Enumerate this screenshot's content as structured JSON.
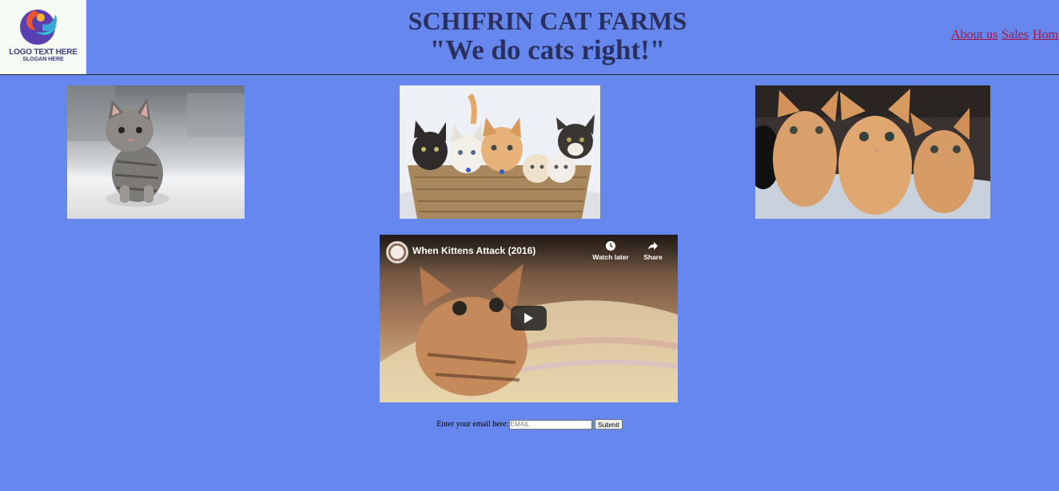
{
  "header": {
    "logo": {
      "text": "LOGO TEXT HERE",
      "slogan": "SLOGAN HERE",
      "colors": [
        "#e8552f",
        "#3aa7d6",
        "#5a3fb0"
      ]
    },
    "title": "SCHIFRIN CAT FARMS",
    "tagline": "\"We do cats right!\""
  },
  "nav": {
    "links": [
      "About us",
      "Sales",
      "Hom"
    ]
  },
  "gallery": {
    "images": [
      {
        "icon": "tabby-kitten-photo"
      },
      {
        "icon": "kittens-in-basket-photo"
      },
      {
        "icon": "orange-kittens-photo"
      }
    ]
  },
  "video": {
    "title": "When Kittens Attack (2016)",
    "watch_later": "Watch later",
    "share": "Share",
    "icons": [
      "clock-icon",
      "share-icon",
      "play-icon"
    ]
  },
  "form": {
    "label": "Enter your email here:",
    "email_placeholder": "EMAIL",
    "submit_label": "Submit"
  },
  "colors": {
    "background": "#6688ee",
    "title": "#2a2f5e",
    "link": "#b0123a"
  }
}
